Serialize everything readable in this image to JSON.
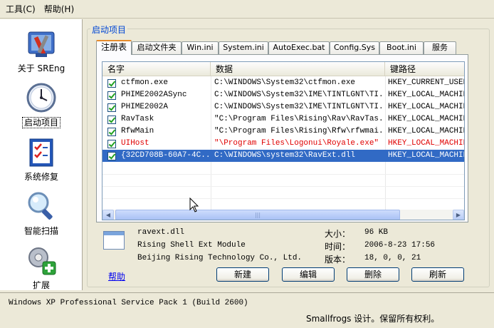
{
  "menu": {
    "tools": "工具(C)",
    "help": "帮助(H)"
  },
  "sidebar": {
    "items": [
      {
        "label": "关于 SREng",
        "icon": "toolbox-icon"
      },
      {
        "label": "启动项目",
        "icon": "clock-icon"
      },
      {
        "label": "系统修复",
        "icon": "checklist-icon"
      },
      {
        "label": "智能扫描",
        "icon": "magnifier-icon"
      },
      {
        "label": "扩展",
        "icon": "puzzle-plus-icon"
      }
    ]
  },
  "group_title": "启动项目",
  "tabs": [
    "注册表",
    "启动文件夹",
    "Win.ini",
    "System.ini",
    "AutoExec.bat",
    "Config.Sys",
    "Boot.ini",
    "服务"
  ],
  "list": {
    "columns": [
      "名字",
      "数据",
      "键路径"
    ],
    "rows": [
      {
        "name": "ctfmon.exe",
        "data": "C:\\WINDOWS\\System32\\ctfmon.exe",
        "path": "HKEY_CURRENT_USER\\"
      },
      {
        "name": "PHIME2002ASync",
        "data": "C:\\WINDOWS\\System32\\IME\\TINTLGNT\\TI...",
        "path": "HKEY_LOCAL_MACHINE"
      },
      {
        "name": "PHIME2002A",
        "data": "C:\\WINDOWS\\System32\\IME\\TINTLGNT\\TI...",
        "path": "HKEY_LOCAL_MACHINE"
      },
      {
        "name": "RavTask",
        "data": "\"C:\\Program Files\\Rising\\Rav\\RavTas...",
        "path": "HKEY_LOCAL_MACHINE"
      },
      {
        "name": "RfwMain",
        "data": "\"C:\\Program Files\\Rising\\Rfw\\rfwmai...",
        "path": "HKEY_LOCAL_MACHINE"
      },
      {
        "name": "UIHost",
        "data": "\"\\Program Files\\Logonui\\Royale.exe\"",
        "path": "HKEY_LOCAL_MACHINE"
      },
      {
        "name": "{32CD708B-60A7-4C...",
        "data": "C:\\WINDOWS\\system32\\RavExt.dll",
        "path": "HKEY_LOCAL_MACHINE"
      }
    ]
  },
  "details": {
    "filename": "ravext.dll",
    "description": "Rising Shell Ext Module",
    "company": "Beijing Rising Technology Co., Ltd.",
    "size_label": "大小：",
    "size_value": "96 KB",
    "time_label": "时间：",
    "time_value": "2006-8-23 17:56",
    "version_label": "版本：",
    "version_value": "18, 0, 0, 21"
  },
  "buttons": {
    "help": "帮助",
    "new": "新建",
    "edit": "编辑",
    "delete": "删除",
    "refresh": "刷新"
  },
  "status": {
    "os": "Windows XP Professional Service Pack 1 (Build 2600)",
    "copyright": "Smallfrogs 设计。保留所有权利。"
  },
  "colors": {
    "selection": "#316ac5",
    "warning_text": "#e00000",
    "group_title": "#0046d5"
  }
}
